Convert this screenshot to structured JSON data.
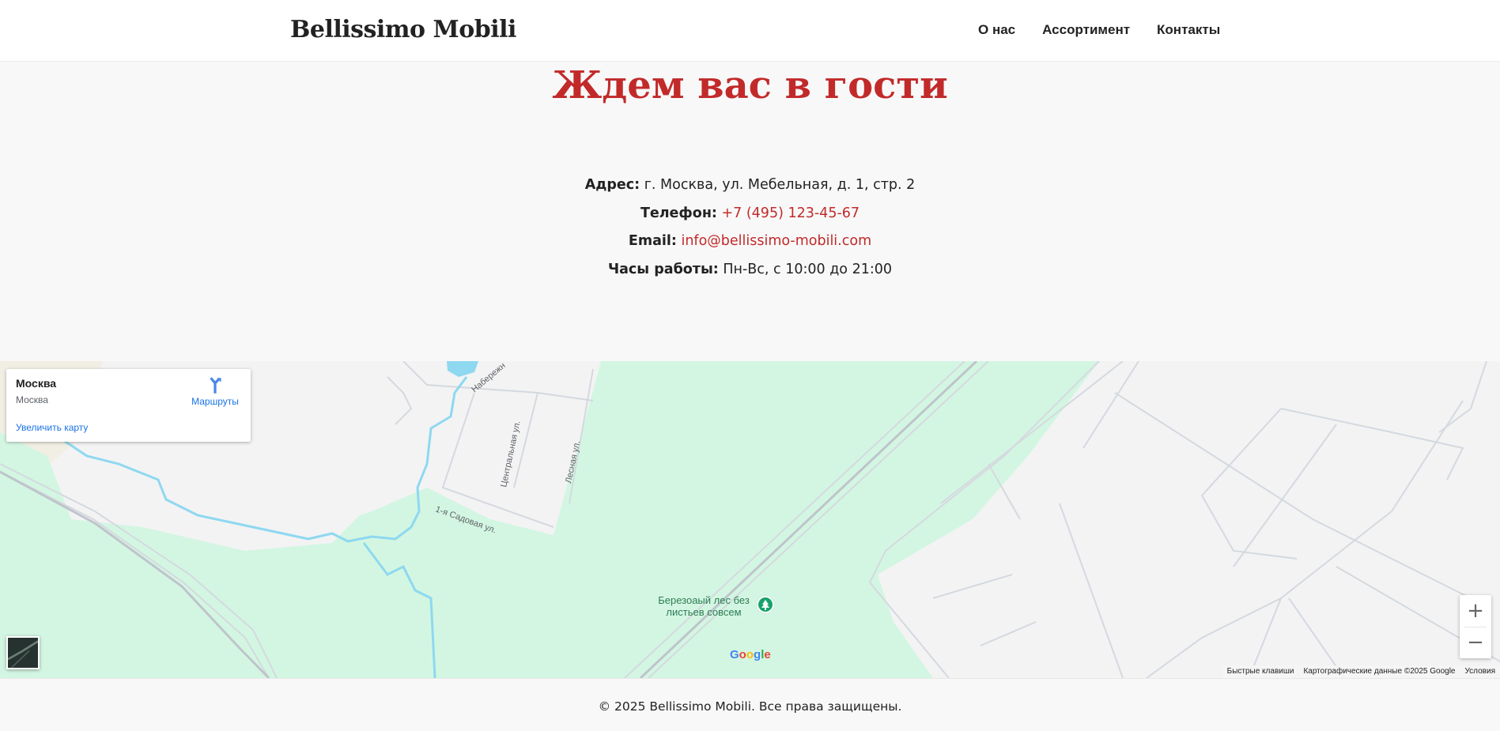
{
  "header": {
    "logo": "Bellissimo Mobili",
    "nav": [
      {
        "label": "О нас"
      },
      {
        "label": "Ассортимент"
      },
      {
        "label": "Контакты"
      }
    ]
  },
  "main": {
    "title": "Ждем вас в гости",
    "contacts": {
      "address_label": "Адрес:",
      "address_value": "г. Москва, ул. Мебельная, д. 1, стр. 2",
      "phone_label": "Телефон:",
      "phone_value": "+7 (495) 123-45-67",
      "email_label": "Email:",
      "email_value": "info@bellissimo-mobili.com",
      "hours_label": "Часы работы:",
      "hours_value": "Пн-Вс, с 10:00 до 21:00"
    }
  },
  "map": {
    "place_name": "Москва",
    "place_address": "Москва",
    "directions_label": "Маршруты",
    "enlarge_label": "Увеличить карту",
    "zoom_in": "+",
    "zoom_out": "−",
    "google_logo": [
      "G",
      "o",
      "o",
      "g",
      "l",
      "e"
    ],
    "poi_label": "Березоаый лес без листьев совсем",
    "street_labels": {
      "naberezhnaya": "Набережн",
      "centralnaya": "Центральная ул.",
      "lesnaya": "Лесная ул.",
      "sadovaya": "1-я Садовая ул."
    },
    "attribution": {
      "shortcuts": "Быстрые клавиши",
      "map_data": "Картографические данные ©2025 Google",
      "terms": "Условия"
    },
    "colors": {
      "park": "#d3f6e2",
      "water": "#8ed8f0",
      "road": "#d4d9df",
      "urban": "#f3f3f4",
      "sand": "#f1efe3"
    }
  },
  "footer": {
    "text": "© 2025 Bellissimo Mobili. Все права защищены."
  }
}
